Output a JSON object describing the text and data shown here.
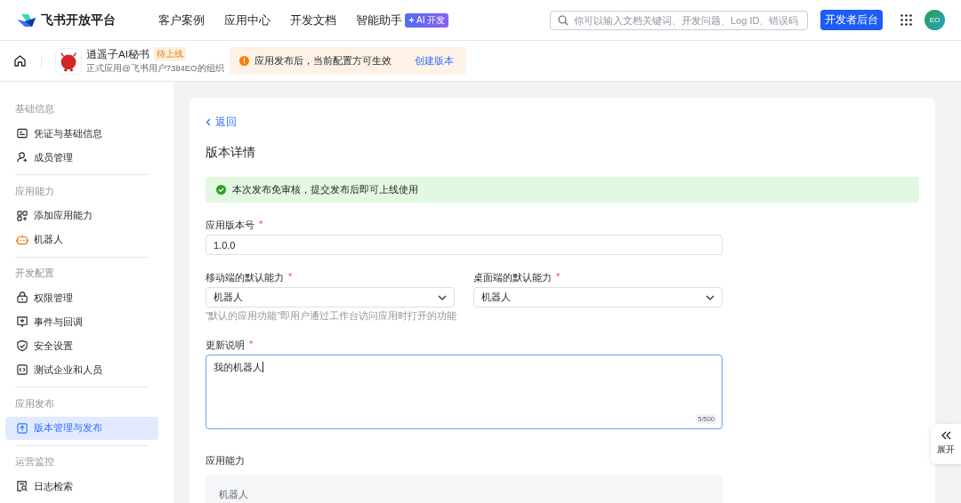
{
  "header": {
    "logo": "飞书开放平台",
    "nav": [
      {
        "label": "客户案例"
      },
      {
        "label": "应用中心"
      },
      {
        "label": "开发文档"
      },
      {
        "label": "智能助手",
        "badge": "AI 开发"
      }
    ],
    "search": {
      "placeholder": "你可以输入文档关键词、开发问题、Log ID、错误码"
    },
    "console_button": "开发者后台",
    "avatar": "EO"
  },
  "app_bar": {
    "app_name": "逍遥子AI秘书",
    "status": "待上线",
    "org": "正式应用@飞书用户7384EO的组织",
    "notice": "应用发布后，当前配置方可生效",
    "notice_link": "创建版本"
  },
  "sidebar": {
    "sections": [
      {
        "title": "基础信息",
        "items": [
          {
            "label": "凭证与基础信息",
            "selected": false
          },
          {
            "label": "成员管理",
            "selected": false
          }
        ]
      },
      {
        "title": "应用能力",
        "items": [
          {
            "label": "添加应用能力",
            "selected": false
          },
          {
            "label": "机器人",
            "selected": false
          }
        ]
      },
      {
        "title": "开发配置",
        "items": [
          {
            "label": "权限管理",
            "selected": false
          },
          {
            "label": "事件与回调",
            "selected": false
          },
          {
            "label": "安全设置",
            "selected": false
          },
          {
            "label": "测试企业和人员",
            "selected": false
          }
        ]
      },
      {
        "title": "应用发布",
        "items": [
          {
            "label": "版本管理与发布",
            "selected": true
          }
        ]
      },
      {
        "title": "运营监控",
        "items": [
          {
            "label": "日志检索",
            "selected": false
          }
        ]
      }
    ]
  },
  "form": {
    "back": "返回",
    "title": "版本详情",
    "banner": "本次发布免审核，提交发布后即可上线使用",
    "version": {
      "label": "应用版本号",
      "required_mark": "*",
      "value": "1.0.0"
    },
    "defaults": [
      {
        "label": "移动端的默认能力",
        "required_mark": "*",
        "value": "机器人"
      },
      {
        "label": "桌面端的默认能力",
        "required_mark": "*",
        "value": "机器人"
      }
    ],
    "defaults_hint": "“默认的应用功能”即用户通过工作台访问应用时打开的功能",
    "notes": {
      "label": "更新说明",
      "required_mark": "*",
      "value": "我的机器人",
      "counter": "5/500",
      "focused": true
    },
    "capabilities": {
      "title": "应用能力",
      "items": [
        "机器人"
      ]
    }
  },
  "expand_tab": {
    "label": "展开"
  }
}
